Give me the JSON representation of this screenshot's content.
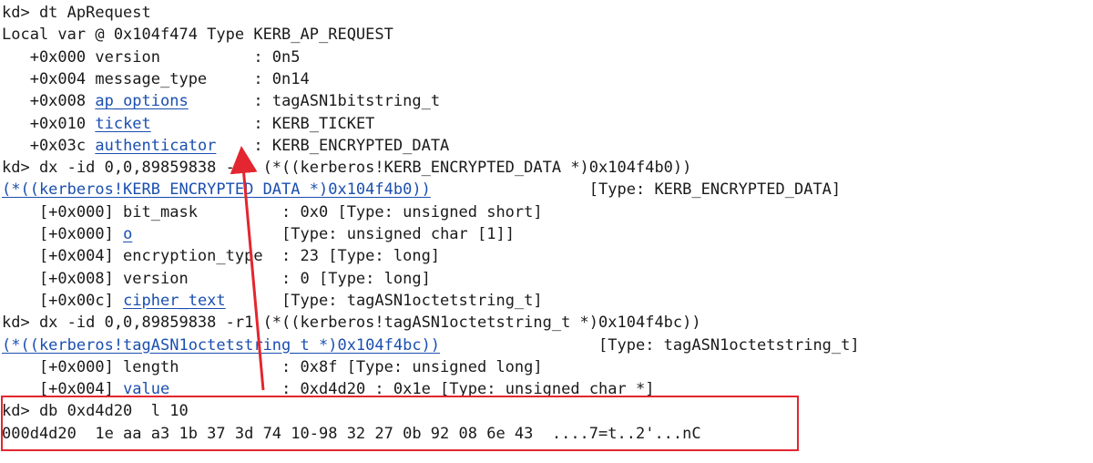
{
  "lines": [
    {
      "segments": [
        {
          "t": "kd> dt ApRequest",
          "link": false
        }
      ]
    },
    {
      "segments": [
        {
          "t": "Local var @ 0x104f474 Type KERB_AP_REQUEST",
          "link": false
        }
      ]
    },
    {
      "segments": [
        {
          "t": "   +0x000 version          : 0n5",
          "link": false
        }
      ]
    },
    {
      "segments": [
        {
          "t": "   +0x004 message_type     : 0n14",
          "link": false
        }
      ]
    },
    {
      "segments": [
        {
          "t": "   +0x008 ",
          "link": false
        },
        {
          "t": "ap_options",
          "link": true
        },
        {
          "t": "       : tagASN1bitstring_t",
          "link": false
        }
      ]
    },
    {
      "segments": [
        {
          "t": "   +0x010 ",
          "link": false
        },
        {
          "t": "ticket",
          "link": true
        },
        {
          "t": "           : KERB_TICKET",
          "link": false
        }
      ]
    },
    {
      "segments": [
        {
          "t": "   +0x03c ",
          "link": false
        },
        {
          "t": "authenticator",
          "link": true
        },
        {
          "t": "    : KERB_ENCRYPTED_DATA",
          "link": false
        }
      ]
    },
    {
      "segments": [
        {
          "t": "kd> dx -id 0,0,89859838 -r1 (*((kerberos!KERB_ENCRYPTED_DATA *)0x104f4b0))",
          "link": false
        }
      ]
    },
    {
      "segments": [
        {
          "t": "(*((kerberos!KERB_ENCRYPTED_DATA *)0x104f4b0))",
          "link": true
        },
        {
          "t": "                 [Type: KERB_ENCRYPTED_DATA]",
          "link": false
        }
      ]
    },
    {
      "segments": [
        {
          "t": "    [+0x000] bit_mask         : 0x0 [Type: unsigned short]",
          "link": false
        }
      ]
    },
    {
      "segments": [
        {
          "t": "    [+0x000] ",
          "link": false
        },
        {
          "t": "o",
          "link": true
        },
        {
          "t": "                [Type: unsigned char [1]]",
          "link": false
        }
      ]
    },
    {
      "segments": [
        {
          "t": "    [+0x004] encryption_type  : 23 [Type: long]",
          "link": false
        }
      ]
    },
    {
      "segments": [
        {
          "t": "    [+0x008] version          : 0 [Type: long]",
          "link": false
        }
      ]
    },
    {
      "segments": [
        {
          "t": "    [+0x00c] ",
          "link": false
        },
        {
          "t": "cipher_text",
          "link": true
        },
        {
          "t": "      [Type: tagASN1octetstring_t]",
          "link": false
        }
      ]
    },
    {
      "segments": [
        {
          "t": "kd> dx -id 0,0,89859838 -r1 (*((kerberos!tagASN1octetstring_t *)0x104f4bc))",
          "link": false
        }
      ]
    },
    {
      "segments": [
        {
          "t": "(*((kerberos!tagASN1octetstring_t *)0x104f4bc))",
          "link": true
        },
        {
          "t": "                 [Type: tagASN1octetstring_t]",
          "link": false
        }
      ]
    },
    {
      "segments": [
        {
          "t": "    [+0x000] length           : 0x8f [Type: unsigned long]",
          "link": false
        }
      ]
    },
    {
      "segments": [
        {
          "t": "    [+0x004] ",
          "link": false
        },
        {
          "t": "value",
          "link": true
        },
        {
          "t": "            : 0xd4d20 : 0x1e [Type: unsigned char *]",
          "link": false
        }
      ]
    },
    {
      "segments": [
        {
          "t": "kd> db 0xd4d20  l 10",
          "link": false
        }
      ]
    },
    {
      "segments": [
        {
          "t": "000d4d20  1e aa a3 1b 37 3d 74 10-98 32 27 0b 92 08 6e 43  ....7=t..2'...nC",
          "link": false
        }
      ]
    }
  ],
  "colors": {
    "link": "#1a4fb0",
    "text": "#1a1a1a",
    "annotation": "#e3262f"
  }
}
